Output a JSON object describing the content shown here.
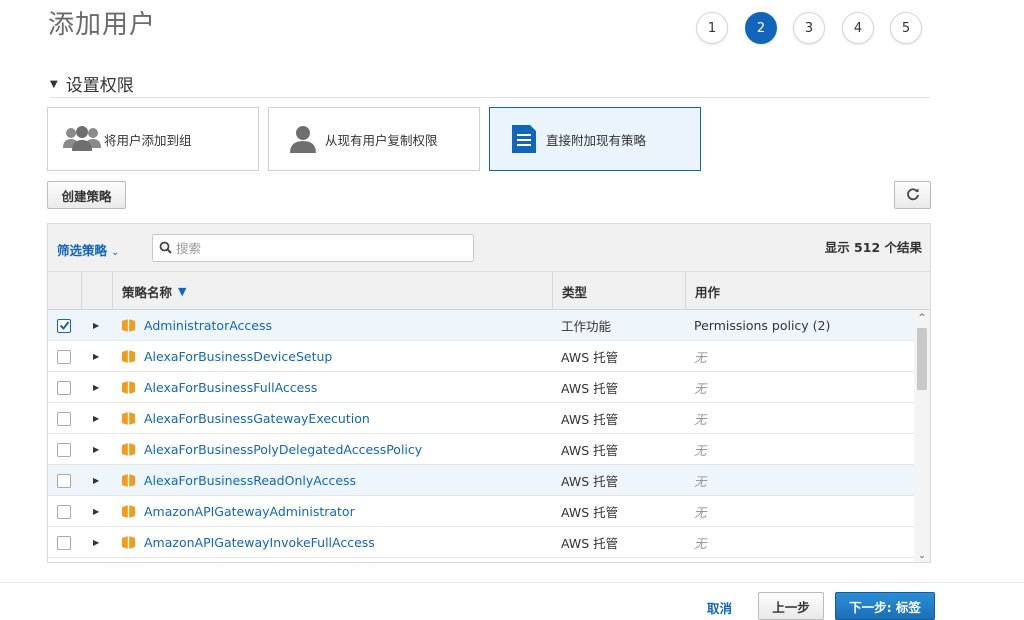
{
  "page": {
    "title": "添加用户"
  },
  "steps": [
    "1",
    "2",
    "3",
    "4",
    "5"
  ],
  "active_step": "2",
  "section": {
    "title": "设置权限"
  },
  "options": [
    {
      "label": "将用户添加到组",
      "icon": "group-icon"
    },
    {
      "label": "从现有用户复制权限",
      "icon": "user-icon"
    },
    {
      "label": "直接附加现有策略",
      "icon": "document-icon",
      "selected": true
    }
  ],
  "buttons": {
    "create_policy": "创建策略",
    "refresh_icon": "refresh-icon"
  },
  "toolbar": {
    "filter_label": "筛选策略",
    "search_placeholder": "搜索",
    "result_count": "显示 512 个结果"
  },
  "table": {
    "headers": {
      "name": "策略名称",
      "type": "类型",
      "usage": "用作"
    },
    "rows": [
      {
        "name": "AdministratorAccess",
        "type": "工作功能",
        "usage": "Permissions policy (2)",
        "checked": true
      },
      {
        "name": "AlexaForBusinessDeviceSetup",
        "type": "AWS 托管",
        "usage": "无",
        "checked": false
      },
      {
        "name": "AlexaForBusinessFullAccess",
        "type": "AWS 托管",
        "usage": "无",
        "checked": false
      },
      {
        "name": "AlexaForBusinessGatewayExecution",
        "type": "AWS 托管",
        "usage": "无",
        "checked": false
      },
      {
        "name": "AlexaForBusinessPolyDelegatedAccessPolicy",
        "type": "AWS 托管",
        "usage": "无",
        "checked": false
      },
      {
        "name": "AlexaForBusinessReadOnlyAccess",
        "type": "AWS 托管",
        "usage": "无",
        "checked": false
      },
      {
        "name": "AmazonAPIGatewayAdministrator",
        "type": "AWS 托管",
        "usage": "无",
        "checked": false
      },
      {
        "name": "AmazonAPIGatewayInvokeFullAccess",
        "type": "AWS 托管",
        "usage": "无",
        "checked": false
      }
    ]
  },
  "footer": {
    "cancel": "取消",
    "previous": "上一步",
    "next": "下一步: 标签"
  },
  "colors": {
    "accent": "#1166bb",
    "selected_bg": "#e9f4fd",
    "policy_icon": "#f29b1d"
  }
}
